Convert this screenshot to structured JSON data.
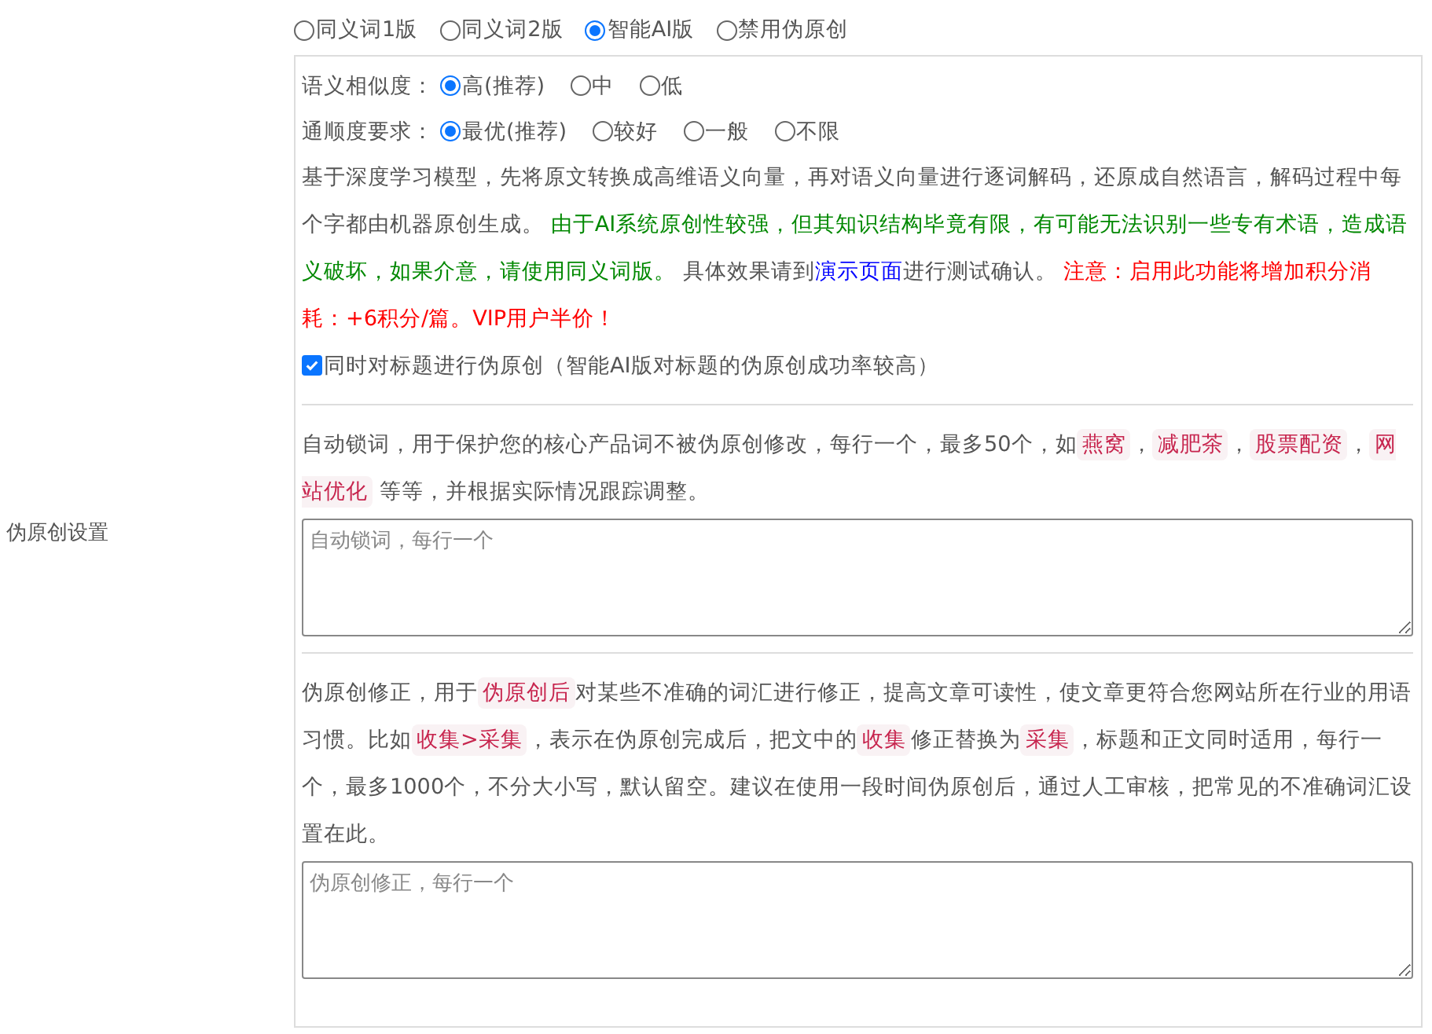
{
  "section_label": "伪原创设置",
  "engine_options": [
    {
      "label": "同义词1版",
      "selected": false
    },
    {
      "label": "同义词2版",
      "selected": false
    },
    {
      "label": "智能AI版",
      "selected": true
    },
    {
      "label": "禁用伪原创",
      "selected": false
    }
  ],
  "similarity": {
    "label": "语义相似度：",
    "options": [
      {
        "label": "高(推荐)",
        "selected": true
      },
      {
        "label": "中",
        "selected": false
      },
      {
        "label": "低",
        "selected": false
      }
    ]
  },
  "fluency": {
    "label": "通顺度要求：",
    "options": [
      {
        "label": "最优(推荐)",
        "selected": true
      },
      {
        "label": "较好",
        "selected": false
      },
      {
        "label": "一般",
        "selected": false
      },
      {
        "label": "不限",
        "selected": false
      }
    ]
  },
  "ai_description": [
    {
      "kind": "plain",
      "text": "基于深度学习模型，先将原文转换成高维语义向量，再对语义向量进行逐词解码，还原成自然语言，解码过程中每个字都由机器原创生成。 "
    },
    {
      "kind": "success",
      "text": "由于AI系统原创性较强，但其知识结构毕竟有限，有可能无法识别一些专有术语，造成语义破坏，如果介意，请使用同义词版。"
    },
    {
      "kind": "plain",
      "text": " 具体效果请到"
    },
    {
      "kind": "link",
      "text": "演示页面"
    },
    {
      "kind": "plain",
      "text": "进行测试确认。 "
    },
    {
      "kind": "warning",
      "text": "注意：启用此功能将增加积分消耗：+6积分/篇。VIP用户半价！"
    }
  ],
  "title_option": {
    "label": "同时对标题进行伪原创（智能AI版对标题的伪原创成功率较高）",
    "checked": true
  },
  "lock_words": {
    "description": [
      {
        "kind": "plain",
        "text": "自动锁词，用于保护您的核心产品词不被伪原创修改，每行一个，最多50个，如"
      },
      {
        "kind": "code",
        "text": "燕窝"
      },
      {
        "kind": "plain",
        "text": "，"
      },
      {
        "kind": "code",
        "text": "减肥茶"
      },
      {
        "kind": "plain",
        "text": "，"
      },
      {
        "kind": "code",
        "text": "股票配资"
      },
      {
        "kind": "plain",
        "text": "，"
      },
      {
        "kind": "code",
        "text": "网站优化"
      },
      {
        "kind": "plain",
        "text": " 等等，并根据实际情况跟踪调整。"
      }
    ],
    "placeholder": "自动锁词，每行一个"
  },
  "correction": {
    "description": [
      {
        "kind": "plain",
        "text": "伪原创修正，用于"
      },
      {
        "kind": "code",
        "text": "伪原创后"
      },
      {
        "kind": "plain",
        "text": "对某些不准确的词汇进行修正，提高文章可读性，使文章更符合您网站所在行业的用语习惯。比如"
      },
      {
        "kind": "code",
        "text": "收集>采集"
      },
      {
        "kind": "plain",
        "text": "，表示在伪原创完成后，把文中的"
      },
      {
        "kind": "code",
        "text": "收集"
      },
      {
        "kind": "plain",
        "text": "修正替换为"
      },
      {
        "kind": "code",
        "text": "采集"
      },
      {
        "kind": "plain",
        "text": "，标题和正文同时适用，每行一个，最多1000个，不分大小写，默认留空。建议在使用一段时间伪原创后，通过人工审核，把常见的不准确词汇设置在此。"
      }
    ],
    "placeholder": "伪原创修正，每行一个"
  }
}
